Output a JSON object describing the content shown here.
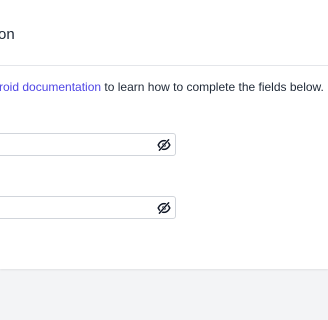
{
  "header": {
    "title": "on"
  },
  "info": {
    "link_text": "roid documentation",
    "rest_text": " to learn how to complete the fields below."
  },
  "fields": [
    {
      "value": "",
      "placeholder": "",
      "icon": "eye-off-icon"
    },
    {
      "value": "",
      "placeholder": "",
      "icon": "eye-off-icon"
    }
  ]
}
